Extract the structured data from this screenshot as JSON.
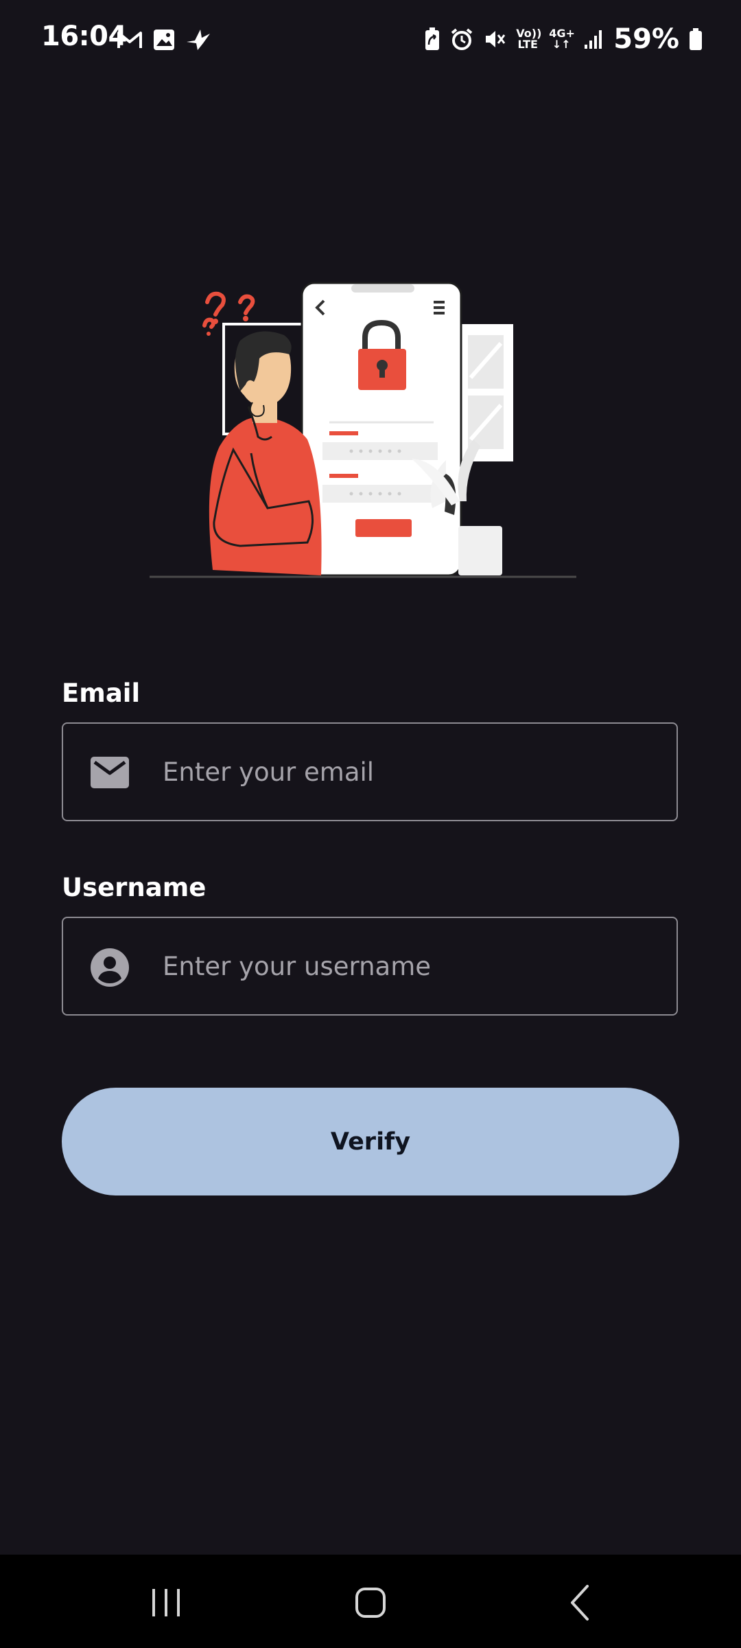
{
  "status_bar": {
    "time": "16:04",
    "battery": "59%",
    "network_volte": "Vo)) LTE",
    "network_4g": "4G+",
    "icons": [
      "gmail-icon",
      "gallery-icon",
      "bird-app-icon",
      "battery-saver-icon",
      "alarm-icon",
      "mute-icon",
      "volte-icon",
      "4g-data-icon",
      "signal-icon",
      "battery-icon"
    ]
  },
  "illustration": {
    "name": "forgot-password-illustration",
    "accent_color": "#e94f3d"
  },
  "form": {
    "email": {
      "label": "Email",
      "placeholder": "Enter your email",
      "value": "",
      "icon": "mail-icon"
    },
    "username": {
      "label": "Username",
      "placeholder": "Enter your username",
      "value": "",
      "icon": "account-circle-icon"
    },
    "submit_label": "Verify",
    "submit_color": "#adc3e0"
  },
  "nav_bar": {
    "buttons": [
      "recents-icon",
      "home-icon",
      "back-icon"
    ]
  }
}
